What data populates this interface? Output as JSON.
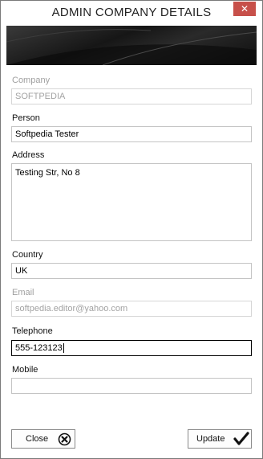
{
  "window": {
    "title": "ADMIN COMPANY DETAILS",
    "close_glyph": "✕"
  },
  "form": {
    "company": {
      "label": "Company",
      "value": "SOFTPEDIA"
    },
    "person": {
      "label": "Person",
      "value": "Softpedia Tester"
    },
    "address": {
      "label": "Address",
      "value": "Testing Str, No 8"
    },
    "country": {
      "label": "Country",
      "value": "UK"
    },
    "email": {
      "label": "Email",
      "value": "softpedia.editor@yahoo.com"
    },
    "telephone": {
      "label": "Telephone",
      "value": "555-123123"
    },
    "mobile": {
      "label": "Mobile",
      "value": ""
    }
  },
  "buttons": {
    "close_label": "Close",
    "update_label": "Update"
  },
  "icons": {
    "close": "close-circle-icon",
    "update": "checkmark-icon",
    "window_close": "close-icon"
  },
  "colors": {
    "close_button_red": "#c7504a",
    "banner_dark": "#161616",
    "disabled_text": "#a0a0a0",
    "focused_border": "#000000"
  }
}
